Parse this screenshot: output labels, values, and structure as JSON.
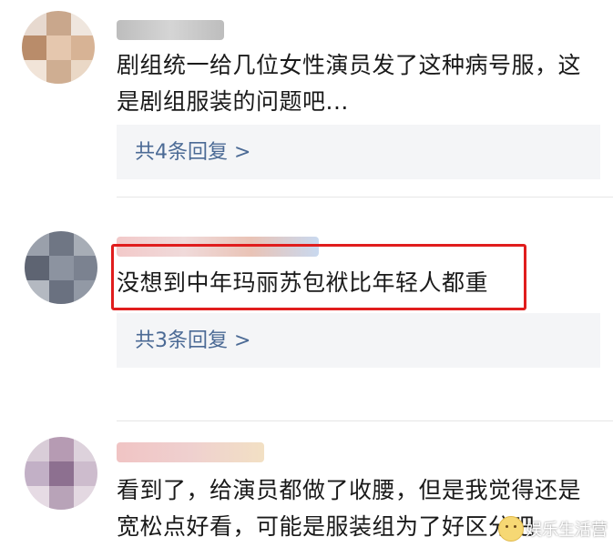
{
  "comments": [
    {
      "text": "剧组统一给几位女性演员发了这种病号服，这是剧组服装的问题吧...",
      "reply_label": "共4条回复 >"
    },
    {
      "text": "没想到中年玛丽苏包袱比年轻人都重",
      "reply_label": "共3条回复 >",
      "highlight_color": "#e01d1d"
    },
    {
      "text": "看到了，给演员都做了收腰，但是我觉得还是宽松点好看，可能是服装组为了好区分吧"
    }
  ],
  "watermark": {
    "text": "娱乐生活营"
  },
  "colors": {
    "reply_link": "#4b6a95",
    "reply_bg": "#f4f5f7",
    "highlight": "#e01d1d"
  }
}
